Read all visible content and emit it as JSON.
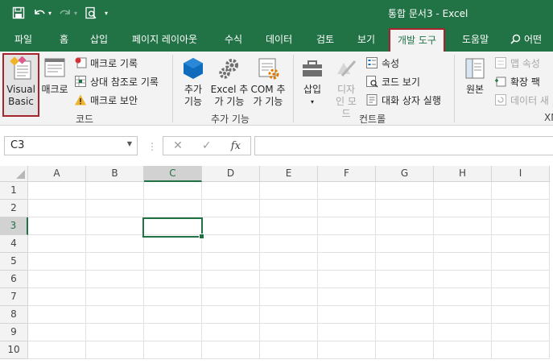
{
  "window": {
    "title": "통합 문서3  -  Excel"
  },
  "tabs": [
    {
      "id": "file",
      "label": "파일"
    },
    {
      "id": "home",
      "label": "홈"
    },
    {
      "id": "insert",
      "label": "삽입"
    },
    {
      "id": "layout",
      "label": "페이지 레이아웃"
    },
    {
      "id": "formulas",
      "label": "수식"
    },
    {
      "id": "data",
      "label": "데이터"
    },
    {
      "id": "review",
      "label": "검토"
    },
    {
      "id": "view",
      "label": "보기"
    },
    {
      "id": "developer",
      "label": "개발 도구",
      "active": true
    },
    {
      "id": "help",
      "label": "도움말"
    }
  ],
  "tell_me": {
    "label": "어떤"
  },
  "ribbon": {
    "code": {
      "group_label": "코드",
      "visual_basic": "Visual Basic",
      "macros": "매크로",
      "record_macro": "매크로 기록",
      "relative_refs": "상대 참조로 기록",
      "macro_security": "매크로 보안"
    },
    "addins": {
      "group_label": "추가 기능",
      "addins": "추가 기능",
      "excel_addins": "Excel 추가 기능",
      "com_addins": "COM 추가 기능"
    },
    "controls": {
      "group_label": "컨트롤",
      "insert": "삽입",
      "design_mode": "디자인 모드",
      "properties": "속성",
      "view_code": "코드 보기",
      "run_dialog": "대화 상자 실행"
    },
    "xml": {
      "group_label": "XM",
      "source": "원본",
      "map_properties": "맵 속성",
      "expansion_packs": "확장 팩",
      "refresh_data": "데이터 새"
    }
  },
  "formula_bar": {
    "name_box": "C3",
    "formula": "",
    "fx": "fx"
  },
  "sheet": {
    "columns": [
      "A",
      "B",
      "C",
      "D",
      "E",
      "F",
      "G",
      "H",
      "I"
    ],
    "rows": [
      "1",
      "2",
      "3",
      "4",
      "5",
      "6",
      "7",
      "8",
      "9",
      "10"
    ],
    "selected_cell": "C3",
    "selected_column": "C",
    "selected_row": "3"
  },
  "colors": {
    "excel_green": "#217346",
    "highlight_border": "#a4262c"
  }
}
